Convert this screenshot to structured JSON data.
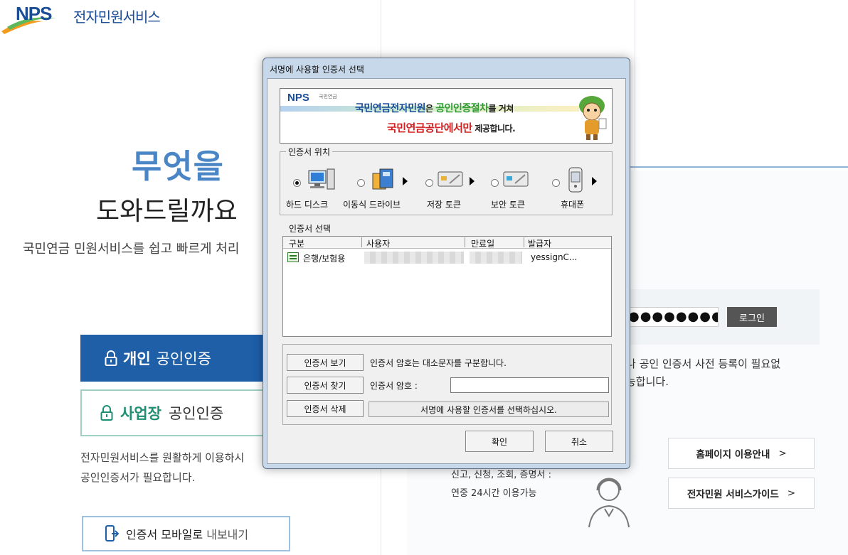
{
  "site": {
    "logo_text": "NPS",
    "logo_subtitle": "전자민원서비스"
  },
  "hero": {
    "line1": "무엇을",
    "line2": "도와드릴까요",
    "line3": "국민연금 민원서비스를 쉽고 빠르게 처리"
  },
  "auth_buttons": {
    "personal_strong": "개인",
    "personal_rest": "공인인증",
    "business_strong": "사업장",
    "business_rest": "공인인증"
  },
  "auth_note": {
    "line1": "전자민원서비스를 원활하게 이용하시",
    "line2": "공인인증서가 필요합니다."
  },
  "mobile_export": {
    "label_strong": "인증서 모바일로",
    "label_rest": "내보내기"
  },
  "login": {
    "password_mask": "●●●●●●●●●",
    "login_label": "로그인"
  },
  "notice": {
    "line1": "나 공인 인증서 사전 등록이 필요없",
    "line2": "능합니다."
  },
  "guides": {
    "homepage_guide": "홈페이지 이용안내",
    "service_guide": "전자민원 서비스가이드",
    "arrow": ">"
  },
  "service_info": {
    "line1": "신고, 신청, 조회, 증명서 :",
    "line2": "연중 24시간 이용가능"
  },
  "dialog": {
    "title": "서명에 사용할 인증서 선택",
    "banner": {
      "logo": "NPS",
      "logo_sub": "국민연금",
      "line1_a": "국민연금전자민원",
      "line1_b": "은 ",
      "line1_c": "공인인증절차",
      "line1_d": "를 거쳐",
      "line2_a": "국민연금공단에서만",
      "line2_b": " 제공합니다."
    },
    "location_group_label": "인증서 위치",
    "locations": [
      {
        "label": "하드 디스크",
        "selected": true
      },
      {
        "label": "이동식 드라이브",
        "selected": false
      },
      {
        "label": "저장 토큰",
        "selected": false
      },
      {
        "label": "보안 토큰",
        "selected": false
      },
      {
        "label": "휴대폰",
        "selected": false
      }
    ],
    "select_label": "인증서 선택",
    "columns": [
      "구분",
      "사용자",
      "만료일",
      "발급자"
    ],
    "rows": [
      {
        "type": "은행/보험용",
        "user": "",
        "expiry": "",
        "issuer": "yessignC..."
      }
    ],
    "view_button": "인증서 보기",
    "find_button": "인증서 찾기",
    "delete_button": "인증서 삭제",
    "case_notice": "인증서 암호는 대소문자를 구분합니다.",
    "password_label": "인증서 암호 :",
    "password_value": "",
    "status": "서명에 사용할 인증서를 선택하십시오.",
    "ok": "확인",
    "cancel": "취소"
  },
  "colors": {
    "brand_blue": "#1e5fa8",
    "hero_blue": "#4a86c5",
    "business_green": "#1f8f74",
    "banner_red": "#d21f1f",
    "banner_green": "#2e9a34"
  }
}
